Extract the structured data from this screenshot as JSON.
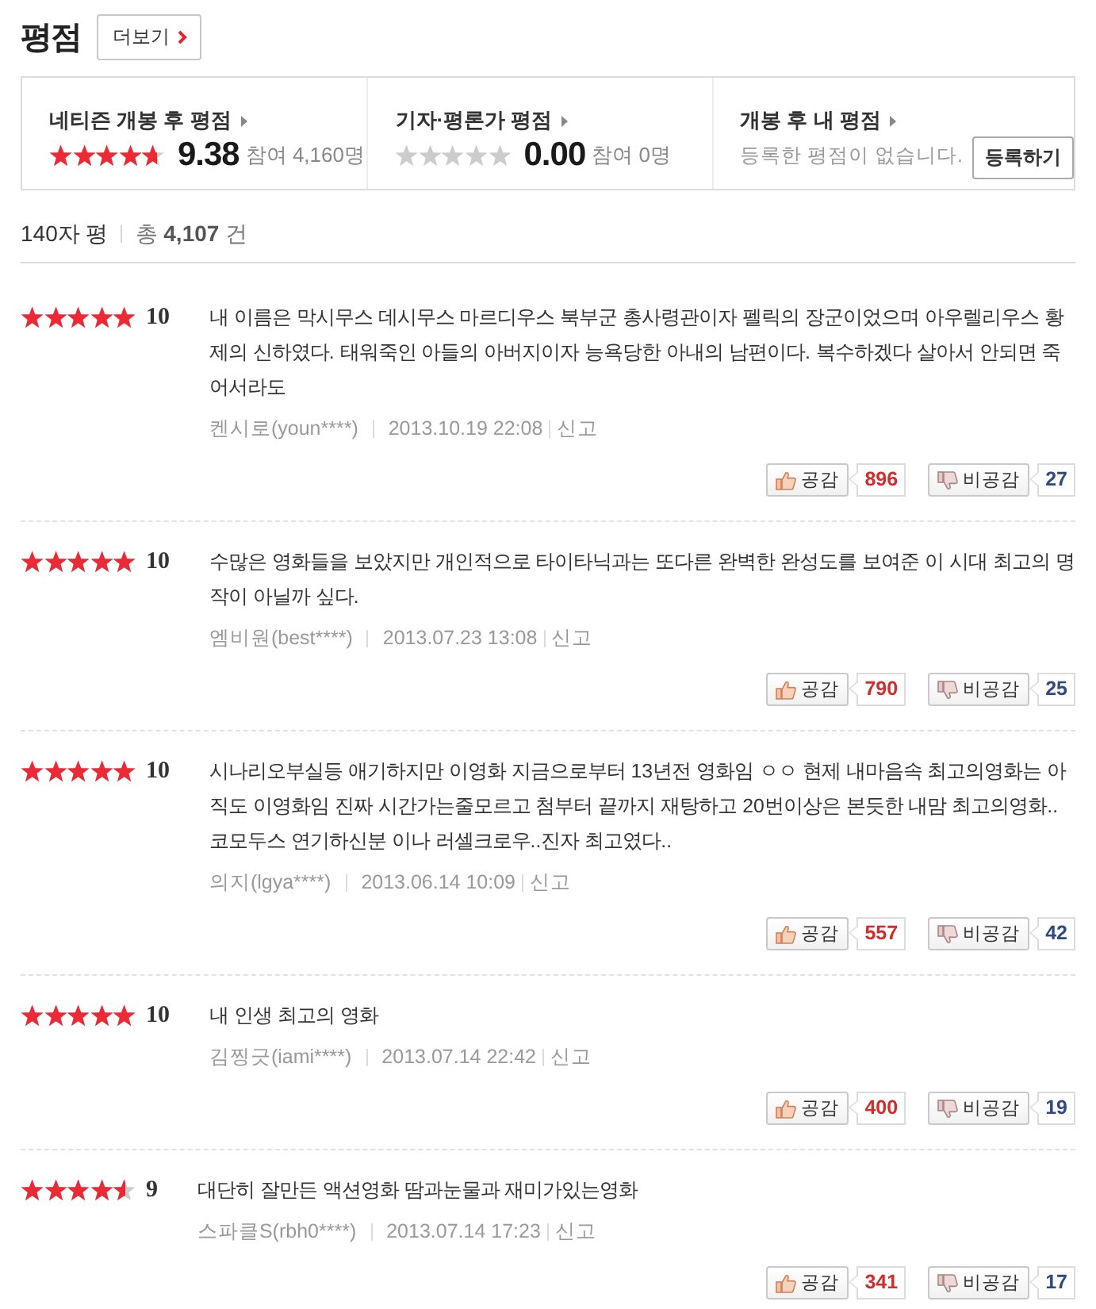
{
  "header": {
    "title": "평점",
    "more_button": "더보기"
  },
  "summary": [
    {
      "kind": "score",
      "label": "네티즌 개봉 후 평점",
      "stars": 4.69,
      "score": "9.38",
      "participants": "참여 4,160명"
    },
    {
      "kind": "score",
      "label": "기자·평론가 평점",
      "stars": 0,
      "score": "0.00",
      "participants": "참여 0명"
    },
    {
      "kind": "mine",
      "label": "개봉 후 내 평점",
      "message": "등록한 평점이 없습니다.",
      "button": "등록하기"
    }
  ],
  "list_header": {
    "title": "140자 평",
    "total": "총 **4,107** 건"
  },
  "reviews": [
    {
      "stars": 5,
      "score": "10",
      "text": "내 이름은 막시무스 데시무스 마르디우스 북부군 총사령관이자 펠릭의 장군이었으며 아우렐리우스 황제의 신하였다. 태워죽인 아들의 아버지이자 능욕당한 아내의 남편이다. 복수하겠다 살아서 안되면 죽어서라도",
      "author": "켄시로(youn****)",
      "date": "2013.10.19 22:08",
      "report": "신고",
      "like_label": "공감",
      "likes": "896",
      "dislike_label": "비공감",
      "dislikes": "27"
    },
    {
      "stars": 5,
      "score": "10",
      "text": "수많은 영화들을 보았지만 개인적으로 타이타닉과는 또다른 완벽한 완성도를 보여준 이 시대 최고의 명작이 아닐까 싶다.",
      "author": "엠비원(best****)",
      "date": "2013.07.23 13:08",
      "report": "신고",
      "like_label": "공감",
      "likes": "790",
      "dislike_label": "비공감",
      "dislikes": "25"
    },
    {
      "stars": 5,
      "score": "10",
      "text": "시나리오부실등 애기하지만 이영화 지금으로부터 13년전 영화임 ㅇㅇ 현제 내마음속 최고의영화는 아직도 이영화임 진짜 시간가는줄모르고 첨부터 끝까지 재탕하고 20번이상은 본듯한 내맘 최고의영화..코모두스 연기하신분 이나 러셀크로우..진자 최고였다..",
      "author": "의지(lgya****)",
      "date": "2013.06.14 10:09",
      "report": "신고",
      "like_label": "공감",
      "likes": "557",
      "dislike_label": "비공감",
      "dislikes": "42"
    },
    {
      "stars": 5,
      "score": "10",
      "text": "내 인생 최고의 영화",
      "author": "김찡긋(iami****)",
      "date": "2013.07.14 22:42",
      "report": "신고",
      "like_label": "공감",
      "likes": "400",
      "dislike_label": "비공감",
      "dislikes": "19"
    },
    {
      "stars": 4.5,
      "score": "9",
      "text": "대단히 잘만든 액션영화 땀과눈물과 재미가있는영화",
      "author": "스파클S(rbh0****)",
      "date": "2013.07.14 17:23",
      "report": "신고",
      "like_label": "공감",
      "likes": "341",
      "dislike_label": "비공감",
      "dislikes": "17"
    }
  ]
}
